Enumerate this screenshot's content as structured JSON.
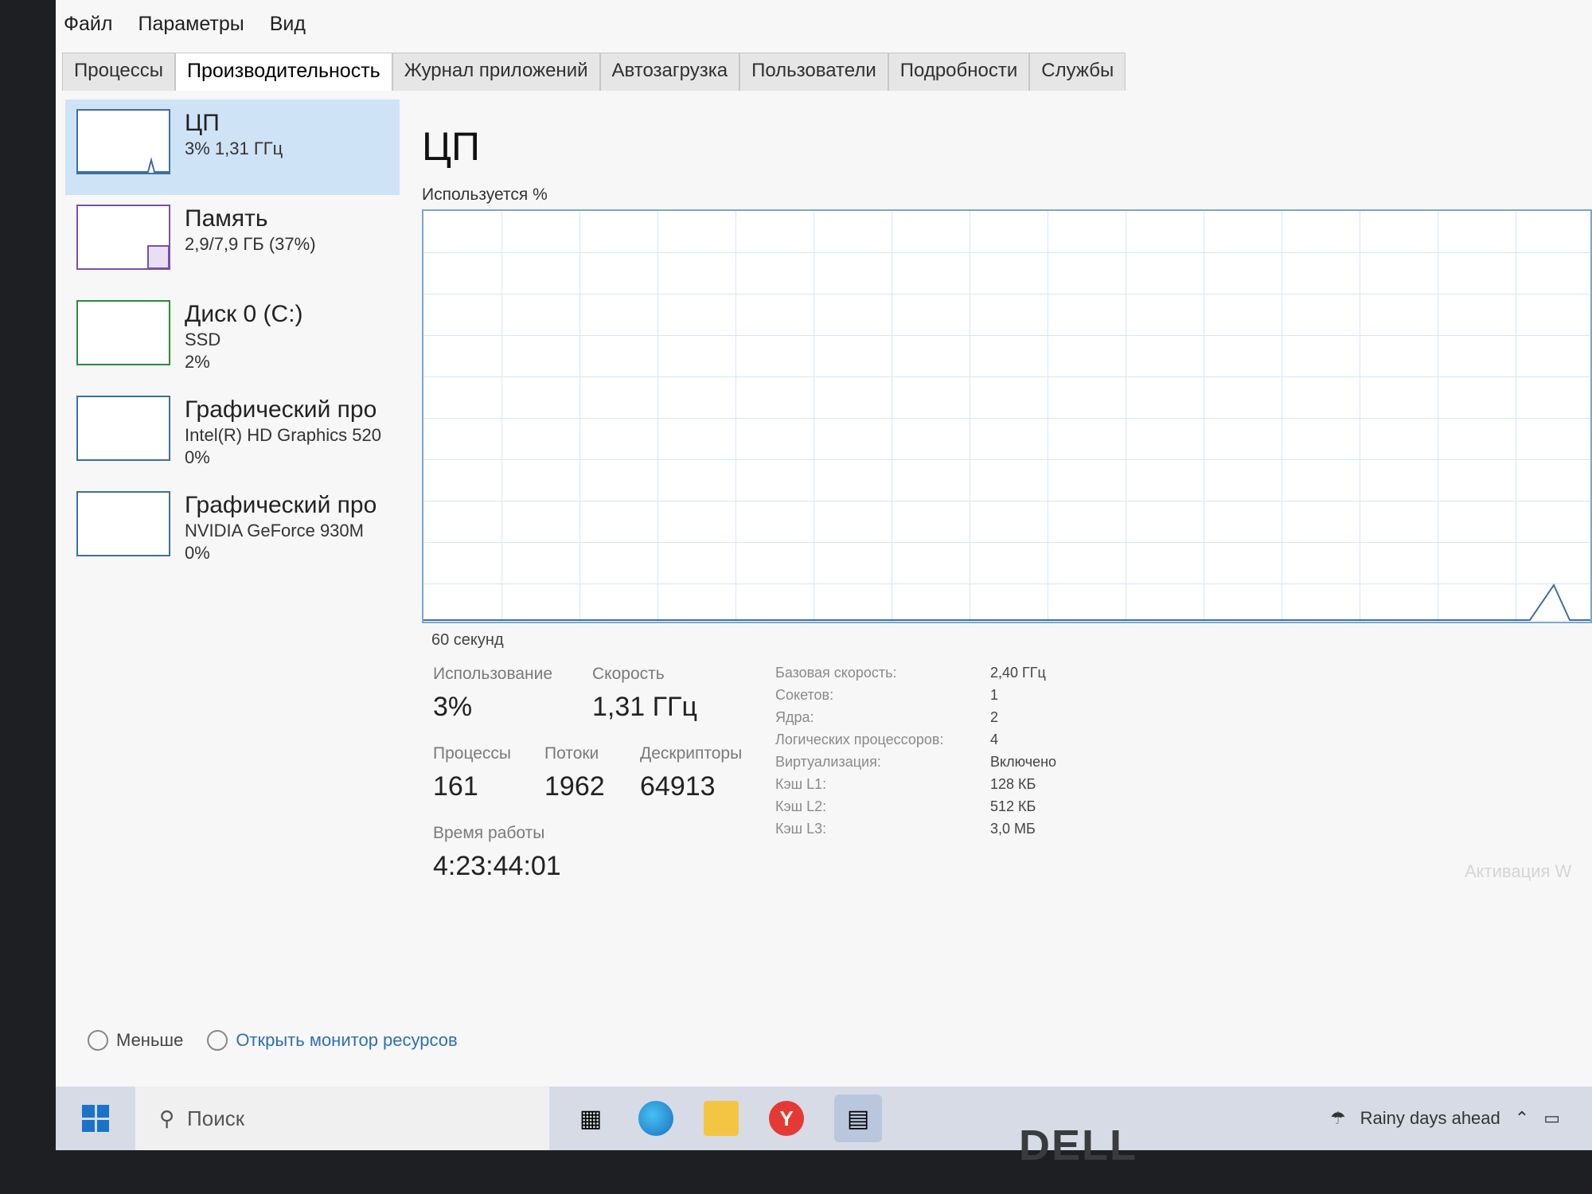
{
  "menu": {
    "file": "Файл",
    "options": "Параметры",
    "view": "Вид"
  },
  "tabs": [
    {
      "label": "Процессы"
    },
    {
      "label": "Производительность"
    },
    {
      "label": "Журнал приложений"
    },
    {
      "label": "Автозагрузка"
    },
    {
      "label": "Пользователи"
    },
    {
      "label": "Подробности"
    },
    {
      "label": "Службы"
    }
  ],
  "sidebar": {
    "items": [
      {
        "title": "ЦП",
        "line1": "3% 1,31 ГГц",
        "line2": ""
      },
      {
        "title": "Память",
        "line1": "2,9/7,9 ГБ (37%)",
        "line2": ""
      },
      {
        "title": "Диск 0 (C:)",
        "line1": "SSD",
        "line2": "2%"
      },
      {
        "title": "Графический про",
        "line1": "Intel(R) HD Graphics 520",
        "line2": "0%"
      },
      {
        "title": "Графический про",
        "line1": "NVIDIA GeForce 930M",
        "line2": "0%"
      }
    ]
  },
  "main": {
    "title": "ЦП",
    "chart_label": "Используется %",
    "time_label": "60 секунд"
  },
  "stats": {
    "usage_label": "Использование",
    "usage_value": "3%",
    "speed_label": "Скорость",
    "speed_value": "1,31 ГГц",
    "processes_label": "Процессы",
    "processes_value": "161",
    "threads_label": "Потоки",
    "threads_value": "1962",
    "handles_label": "Дескрипторы",
    "handles_value": "64913",
    "uptime_label": "Время работы",
    "uptime_value": "4:23:44:01"
  },
  "details": [
    {
      "key": "Базовая скорость:",
      "value": "2,40 ГГц"
    },
    {
      "key": "Сокетов:",
      "value": "1"
    },
    {
      "key": "Ядра:",
      "value": "2"
    },
    {
      "key": "Логических процессоров:",
      "value": "4"
    },
    {
      "key": "Виртуализация:",
      "value": "Включено"
    },
    {
      "key": "Кэш L1:",
      "value": "128 КБ"
    },
    {
      "key": "Кэш L2:",
      "value": "512 КБ"
    },
    {
      "key": "Кэш L3:",
      "value": "3,0 МБ"
    }
  ],
  "footer": {
    "less": "Меньше",
    "monitor": "Открыть монитор ресурсов"
  },
  "taskbar": {
    "search": "Поиск",
    "weather": "Rainy days ahead"
  },
  "watermark": {
    "line1": "Активация W"
  },
  "brand": "DELL",
  "colors": {
    "accent": "#3d6fa3",
    "selected": "#cfe3f6",
    "grid": "#d6e6f4"
  }
}
